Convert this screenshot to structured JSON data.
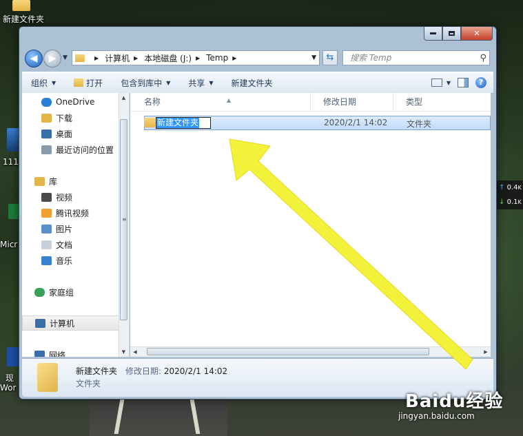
{
  "desktop": {
    "icons": [
      {
        "label": "新建文件夹"
      },
      {
        "label": "111"
      },
      {
        "label": "Micr"
      },
      {
        "label": "现"
      },
      {
        "label": "Wor"
      }
    ],
    "net_widget": {
      "up": "0.4",
      "down": "0.1",
      "up_unit": "K",
      "down_unit": "K"
    }
  },
  "window": {
    "address": {
      "crumbs": [
        "计算机",
        "本地磁盘 (J:)",
        "Temp"
      ]
    },
    "search_placeholder": "搜索 Temp",
    "toolbar": {
      "organize": "组织",
      "open": "打开",
      "include_library": "包含到库中",
      "share": "共享",
      "new_folder": "新建文件夹"
    },
    "sidebar": {
      "items": [
        {
          "label": "OneDrive",
          "icon": "cloud-icon",
          "color": "#2a7fd6"
        },
        {
          "label": "下载",
          "icon": "download-folder-icon",
          "color": "#e3b548"
        },
        {
          "label": "桌面",
          "icon": "desktop-icon",
          "color": "#3a6ea8"
        },
        {
          "label": "最近访问的位置",
          "icon": "recent-places-icon",
          "color": "#8a9aaa"
        },
        {
          "label": "库",
          "icon": "library-icon",
          "color": "#e3b548"
        },
        {
          "label": "视频",
          "icon": "video-icon",
          "color": "#4a4a4a"
        },
        {
          "label": "腾讯视频",
          "icon": "tencent-video-icon",
          "color": "#f0a030"
        },
        {
          "label": "图片",
          "icon": "pictures-icon",
          "color": "#5a8fc8"
        },
        {
          "label": "文档",
          "icon": "documents-icon",
          "color": "#c8d0dc"
        },
        {
          "label": "音乐",
          "icon": "music-icon",
          "color": "#3a7fd0"
        },
        {
          "label": "家庭组",
          "icon": "homegroup-icon",
          "color": "#3aa05a"
        },
        {
          "label": "计算机",
          "icon": "computer-icon",
          "color": "#3a6ea8"
        },
        {
          "label": "网络",
          "icon": "network-icon",
          "color": "#3a6ea8"
        }
      ]
    },
    "columns": {
      "name": "名称",
      "modified": "修改日期",
      "type": "类型"
    },
    "files": [
      {
        "name": "新建文件夹",
        "modified": "2020/2/1 14:02",
        "type": "文件夹"
      }
    ],
    "details": {
      "name": "新建文件夹",
      "modified_label": "修改日期:",
      "modified": "2020/2/1 14:02",
      "type": "文件夹"
    }
  },
  "watermark": {
    "brand": "Baidu经验",
    "url": "jingyan.baidu.com"
  },
  "colors": {
    "annotation_arrow": "#f2f23a",
    "selection": "#3297fd"
  }
}
